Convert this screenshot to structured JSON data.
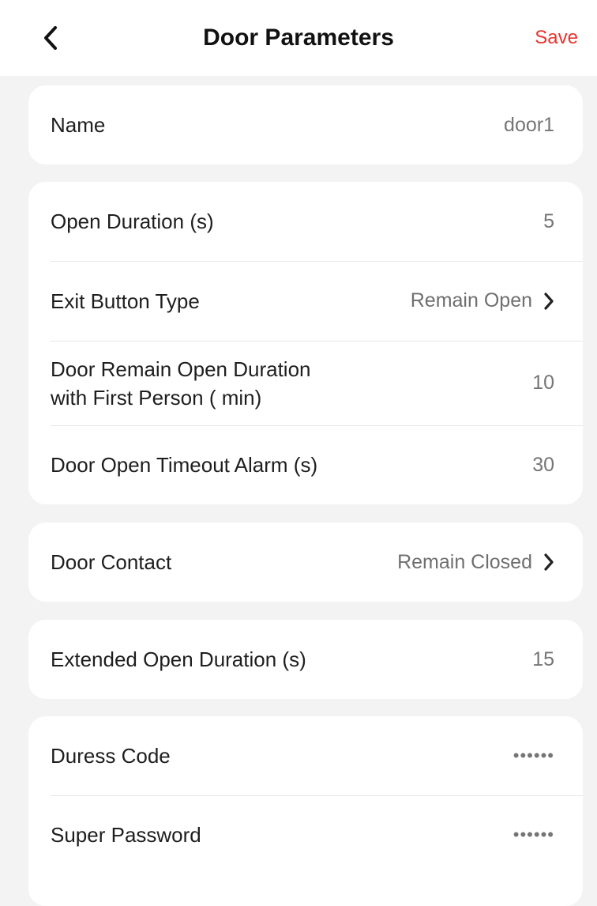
{
  "header": {
    "title": "Door Parameters",
    "save_label": "Save"
  },
  "cards": {
    "name": {
      "label": "Name",
      "value": "door1"
    },
    "timing": {
      "open_duration": {
        "label": "Open Duration (s)",
        "value": "5"
      },
      "exit_button": {
        "label": "Exit Button Type",
        "value": "Remain Open"
      },
      "remain_open_first_person": {
        "label_line1": "Door Remain Open Duration",
        "label_line2": "with First Person ( min)",
        "value": "10"
      },
      "open_timeout_alarm": {
        "label": "Door Open Timeout Alarm (s)",
        "value": "30"
      }
    },
    "contact": {
      "label": "Door Contact",
      "value": "Remain Closed"
    },
    "extended": {
      "label": "Extended Open Duration (s)",
      "value": "15"
    },
    "security": {
      "duress_code": {
        "label": "Duress Code",
        "value": "••••••"
      },
      "super_password": {
        "label": "Super Password",
        "value": "••••••"
      }
    }
  },
  "colors": {
    "accent": "#e8342f",
    "background": "#f3f3f4",
    "card": "#ffffff",
    "value_text": "#757575"
  },
  "icons": {
    "back": "chevron-left-icon",
    "row_chevron": "chevron-right-icon"
  }
}
